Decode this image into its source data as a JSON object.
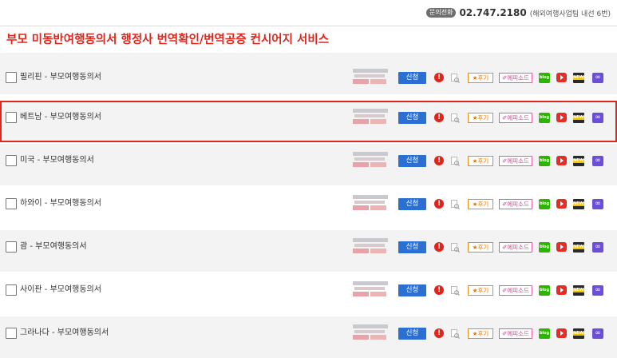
{
  "contact": {
    "badge": "문의전화",
    "number": "02.747.2180",
    "note": "(해외여행사업팀 내선 6번)"
  },
  "page_title": "부모 미동반여행동의서 행정사 번역확인/번역공증 컨시어지 서비스",
  "row_actions": {
    "apply_label": "신청",
    "alert_glyph": "!",
    "review_label": "★후기",
    "episode_label": "✐에피소드",
    "blog_label": "blog",
    "news_label": "NEWS",
    "link_glyph": "∞"
  },
  "icons": {
    "alert": "alert-icon",
    "search_doc": "search-doc-icon",
    "blog": "blog-icon",
    "youtube": "youtube-icon",
    "news": "news-icon",
    "link": "link-icon"
  },
  "colors": {
    "title_red": "#e0251b",
    "apply_blue": "#2c6fd3",
    "highlight_border": "#e02424",
    "review_orange": "#f08a17",
    "episode_pink": "#e75aa6",
    "blog_green": "#2db400",
    "youtube_red": "#e52d27",
    "link_purple": "#6b4fd8"
  },
  "rows": [
    {
      "label": "필리핀 - 부모여행동의서",
      "highlighted": false
    },
    {
      "label": "베트남 - 부모여행동의서",
      "highlighted": true
    },
    {
      "label": "미국 - 부모여행동의서",
      "highlighted": false
    },
    {
      "label": "하와이 - 부모여행동의서",
      "highlighted": false
    },
    {
      "label": "괌 - 부모여행동의서",
      "highlighted": false
    },
    {
      "label": "사이판 - 부모여행동의서",
      "highlighted": false
    },
    {
      "label": "그라나다 - 부모여행동의서",
      "highlighted": false
    }
  ]
}
